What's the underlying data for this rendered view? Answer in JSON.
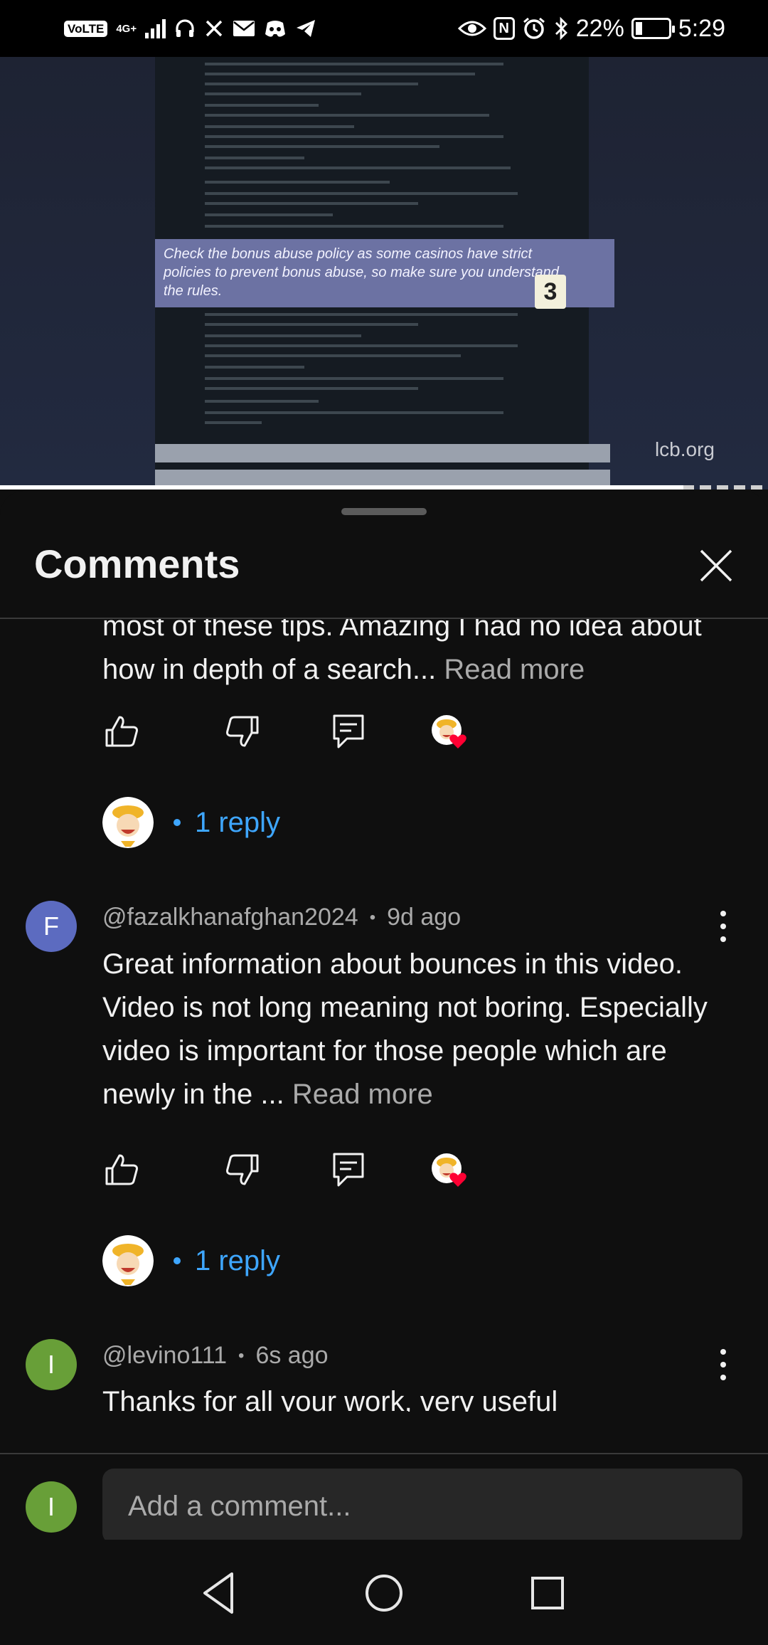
{
  "status_bar": {
    "volte": "VoLTE",
    "network": "4G+",
    "battery": "22%",
    "battery_level": 0.22,
    "time": "5:29",
    "icons": [
      "headphones-icon",
      "x-icon",
      "mail-icon",
      "discord-icon",
      "telegram-icon",
      "eye-icon",
      "nfc-icon",
      "alarm-icon",
      "bluetooth-icon",
      "battery-icon"
    ]
  },
  "video": {
    "highlight_text": "Check the bonus abuse policy as some casinos have strict policies to prevent bonus abuse, so make sure you understand the rules.",
    "badge": "3",
    "watermark": "lcb.org",
    "progress": 0.89
  },
  "sheet": {
    "title": "Comments",
    "close_icon": "close-icon"
  },
  "comments": [
    {
      "body": "most of these tips. Amazing I had no idea about how in depth of a search...",
      "read_more": "Read more",
      "reply_label": "1 reply"
    },
    {
      "avatar_letter": "F",
      "avatar_color": "#5c6bc0",
      "author": "@fazalkhanafghan2024",
      "time": "9d ago",
      "body": "Great information about bounces in this video. Video is not long meaning not boring. Especially video is important for those people which are newly in the ...",
      "read_more": "Read more",
      "reply_label": "1 reply"
    },
    {
      "avatar_letter": "I",
      "avatar_color": "#689f38",
      "author": "@levino111",
      "time": "6s ago",
      "body": "Thanks for all your work, very useful"
    }
  ],
  "composer": {
    "avatar_letter": "I",
    "avatar_color": "#689f38",
    "placeholder": "Add a comment..."
  },
  "colors": {
    "background": "#0f0f0f",
    "link_blue": "#3ea6ff",
    "secondary_text": "#aaaaaa",
    "like_heart": "#ff0033"
  }
}
